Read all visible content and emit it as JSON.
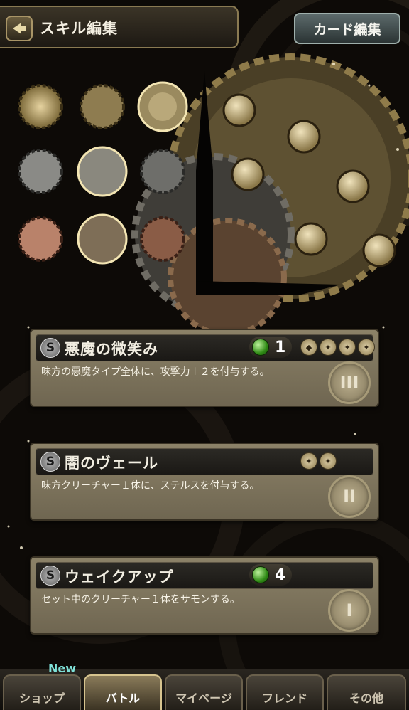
{
  "header": {
    "title": "スキル編集",
    "card_edit_label": "カード編集"
  },
  "skills": [
    {
      "badge": "S",
      "name": "悪魔の微笑み",
      "cost": "1",
      "description": "味方の悪魔タイプ全体に、攻撃力＋２を付与する。",
      "level": "III"
    },
    {
      "badge": "S",
      "name": "闇のヴェール",
      "description": "味方クリーチャー１体に、ステルスを付与する。",
      "level": "II"
    },
    {
      "badge": "S",
      "name": "ウェイクアップ",
      "cost": "4",
      "description": "セット中のクリーチャー１体をサモンする。",
      "level": "I"
    }
  ],
  "nav": {
    "new_label": "New",
    "tabs": [
      "ショップ",
      "バトル",
      "マイページ",
      "フレンド",
      "その他"
    ],
    "active": "バトル"
  },
  "colors": {
    "gold": "#c9b27a",
    "silver": "#a0a0a0",
    "bronze": "#b98462",
    "gem_green": "#3fa51f"
  }
}
